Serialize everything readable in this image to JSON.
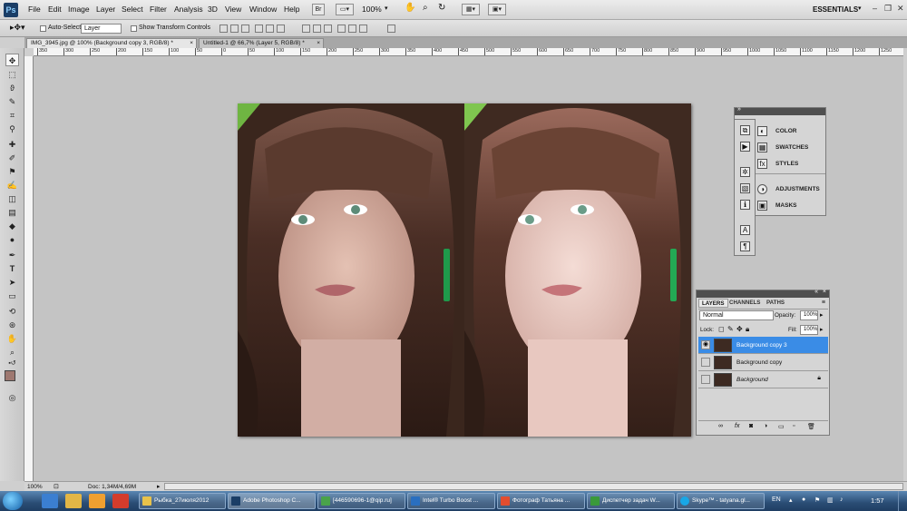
{
  "app": {
    "logo": "Ps",
    "workspace": "ESSENTIALS",
    "zoom_dropdown": "100%"
  },
  "menu": [
    "File",
    "Edit",
    "Image",
    "Layer",
    "Select",
    "Filter",
    "Analysis",
    "3D",
    "View",
    "Window",
    "Help"
  ],
  "options_bar": {
    "auto_select_label": "Auto-Select:",
    "auto_select_value": "Layer",
    "show_transform_label": "Show Transform Controls"
  },
  "tabs": [
    {
      "label": "IMG_3945.jpg @ 100% (Background copy 3, RGB/8) *",
      "active": true
    },
    {
      "label": "Untitled-1 @ 66,7% (Layer 5, RGB/8) *",
      "active": false
    }
  ],
  "ruler_ticks": [
    "350",
    "300",
    "250",
    "200",
    "150",
    "100",
    "50",
    "0",
    "50",
    "100",
    "150",
    "200",
    "250",
    "300",
    "350",
    "400",
    "450",
    "500",
    "550",
    "600",
    "650",
    "700",
    "750",
    "800",
    "850",
    "900",
    "950",
    "1000",
    "1050",
    "1100",
    "1150",
    "1200",
    "1250"
  ],
  "panels_top": {
    "group1": [
      {
        "icon": "color-icon",
        "label": "COLOR"
      },
      {
        "icon": "swatches-icon",
        "label": "SWATCHES"
      },
      {
        "icon": "styles-icon",
        "label": "STYLES"
      }
    ],
    "group2": [
      {
        "icon": "adjustments-icon",
        "label": "ADJUSTMENTS"
      },
      {
        "icon": "masks-icon",
        "label": "MASKS"
      }
    ]
  },
  "layers_panel": {
    "tabs": [
      "LAYERS",
      "CHANNELS",
      "PATHS"
    ],
    "blend_mode": "Normal",
    "opacity_label": "Opacity:",
    "opacity_value": "100%",
    "lock_label": "Lock:",
    "fill_label": "Fill:",
    "fill_value": "100%",
    "layers": [
      {
        "name": "Background copy 3",
        "selected": true,
        "visible": true
      },
      {
        "name": "Background copy",
        "selected": false,
        "visible": false
      },
      {
        "name": "Background",
        "selected": false,
        "visible": false,
        "locked": true
      }
    ]
  },
  "status": {
    "zoom": "100%",
    "doc": "Doc: 1,34M/4,69M"
  },
  "taskbar": {
    "tasks": [
      {
        "label": "Рыбка_27июля2012",
        "color": "#e8c24a"
      },
      {
        "label": "Adobe Photoshop C...",
        "color": "#1b3e66"
      },
      {
        "label": "[446590696-1@qip.ru]",
        "color": "#4aa34a"
      },
      {
        "label": "Intel® Turbo Boost ...",
        "color": "#2a6fc0"
      },
      {
        "label": "Фотограф Татьяна ...",
        "color": "#e34d2f"
      },
      {
        "label": "Диспетчер задач W...",
        "color": "#3a9a3a"
      },
      {
        "label": "Skype™ - tatyana.gl...",
        "color": "#19a7e6"
      }
    ],
    "lang": "EN",
    "time": "1:57"
  }
}
